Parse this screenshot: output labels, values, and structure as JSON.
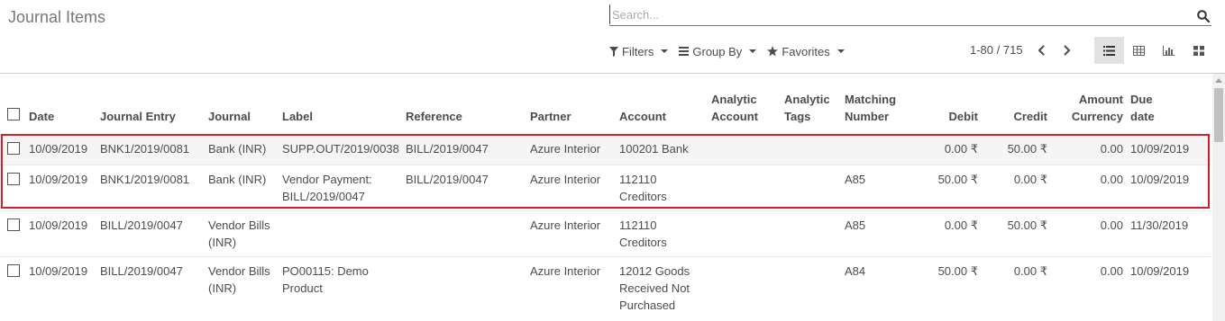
{
  "header": {
    "title": "Journal Items",
    "search_placeholder": "Search...",
    "filters_label": "Filters",
    "groupby_label": "Group By",
    "favorites_label": "Favorites",
    "pager": "1-80 / 715"
  },
  "columns": {
    "date": "Date",
    "journal_entry": "Journal Entry",
    "journal": "Journal",
    "label": "Label",
    "reference": "Reference",
    "partner": "Partner",
    "account": "Account",
    "analytic_account_1": "Analytic",
    "analytic_account_2": "Account",
    "analytic_tags_1": "Analytic",
    "analytic_tags_2": "Tags",
    "matching_number_1": "Matching",
    "matching_number_2": "Number",
    "debit": "Debit",
    "credit": "Credit",
    "amount_currency_1": "Amount",
    "amount_currency_2": "Currency",
    "due_date_1": "Due",
    "due_date_2": "date"
  },
  "rows": [
    {
      "date": "10/09/2019",
      "journal_entry": "BNK1/2019/0081",
      "journal": "Bank (INR)",
      "label": "SUPP.OUT/2019/0038",
      "reference": "BILL/2019/0047",
      "partner": "Azure Interior",
      "account": "100201 Bank",
      "analytic_account": "",
      "analytic_tags": "",
      "matching_number": "",
      "debit": "0.00 ₹",
      "credit": "50.00 ₹",
      "amount_currency": "0.00",
      "due_date": "10/09/2019"
    },
    {
      "date": "10/09/2019",
      "journal_entry": "BNK1/2019/0081",
      "journal": "Bank (INR)",
      "label": "Vendor Payment: BILL/2019/0047",
      "reference": "BILL/2019/0047",
      "partner": "Azure Interior",
      "account": "112110 Creditors",
      "analytic_account": "",
      "analytic_tags": "",
      "matching_number": "A85",
      "debit": "50.00 ₹",
      "credit": "0.00 ₹",
      "amount_currency": "0.00",
      "due_date": "10/09/2019"
    },
    {
      "date": "10/09/2019",
      "journal_entry": "BILL/2019/0047",
      "journal": "Vendor Bills (INR)",
      "label": "",
      "reference": "",
      "partner": "Azure Interior",
      "account": "112110 Creditors",
      "analytic_account": "",
      "analytic_tags": "",
      "matching_number": "A85",
      "debit": "0.00 ₹",
      "credit": "50.00 ₹",
      "amount_currency": "0.00",
      "due_date": "11/30/2019"
    },
    {
      "date": "10/09/2019",
      "journal_entry": "BILL/2019/0047",
      "journal": "Vendor Bills (INR)",
      "label": "PO00115: Demo Product",
      "reference": "",
      "partner": "Azure Interior",
      "account": "12012 Goods Received Not Purchased",
      "analytic_account": "",
      "analytic_tags": "",
      "matching_number": "A84",
      "debit": "50.00 ₹",
      "credit": "0.00 ₹",
      "amount_currency": "0.00",
      "due_date": "10/09/2019"
    }
  ],
  "colors": {
    "highlight": "#d4202c",
    "selected_row": "#f5f5f5"
  },
  "icons": {
    "search": "search-icon",
    "filter": "filter-icon",
    "groupby": "list-lines-icon",
    "favorites": "star-icon",
    "prev": "chevron-left-icon",
    "next": "chevron-right-icon",
    "list_view": "list-view-icon",
    "pivot_view": "pivot-view-icon",
    "graph_view": "graph-view-icon",
    "kanban_view": "kanban-view-icon"
  }
}
